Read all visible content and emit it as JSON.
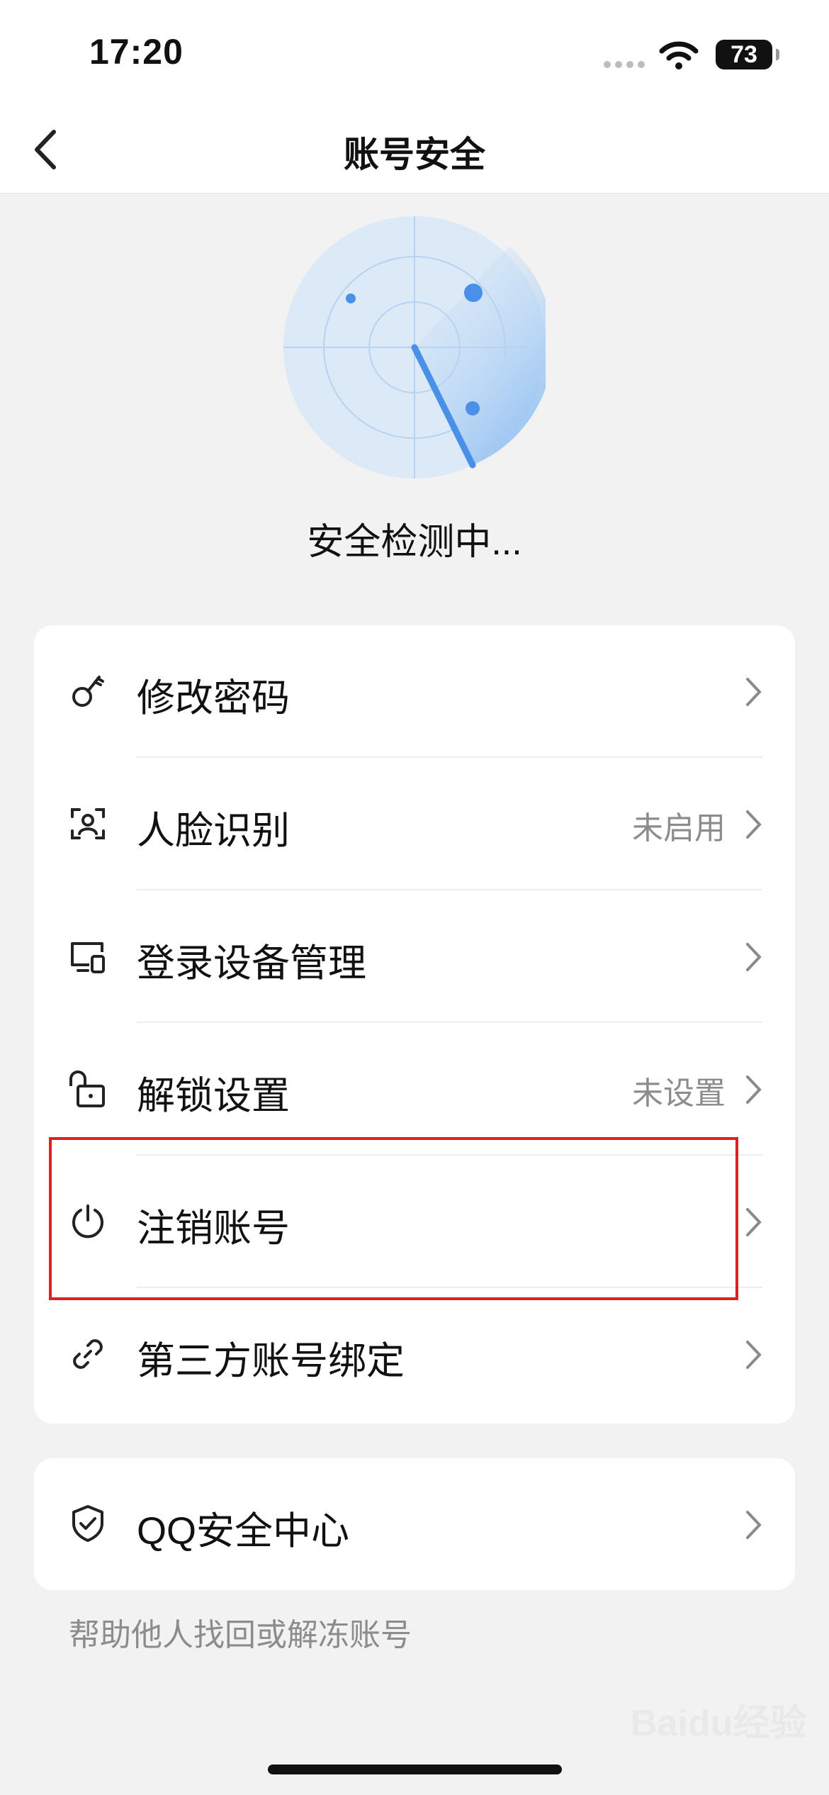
{
  "status_bar": {
    "time": "17:20",
    "battery": "73"
  },
  "nav": {
    "title": "账号安全"
  },
  "scan": {
    "status": "安全检测中..."
  },
  "menu": [
    {
      "label": "修改密码",
      "status": ""
    },
    {
      "label": "人脸识别",
      "status": "未启用"
    },
    {
      "label": "登录设备管理",
      "status": ""
    },
    {
      "label": "解锁设置",
      "status": "未设置"
    },
    {
      "label": "注销账号",
      "status": ""
    },
    {
      "label": "第三方账号绑定",
      "status": ""
    }
  ],
  "qq_center": {
    "label": "QQ安全中心"
  },
  "help": {
    "text": "帮助他人找回或解冻账号"
  },
  "watermark": {
    "text": "Baidu经验"
  },
  "colors": {
    "accent": "#4a90e8",
    "highlight": "#e02020"
  }
}
